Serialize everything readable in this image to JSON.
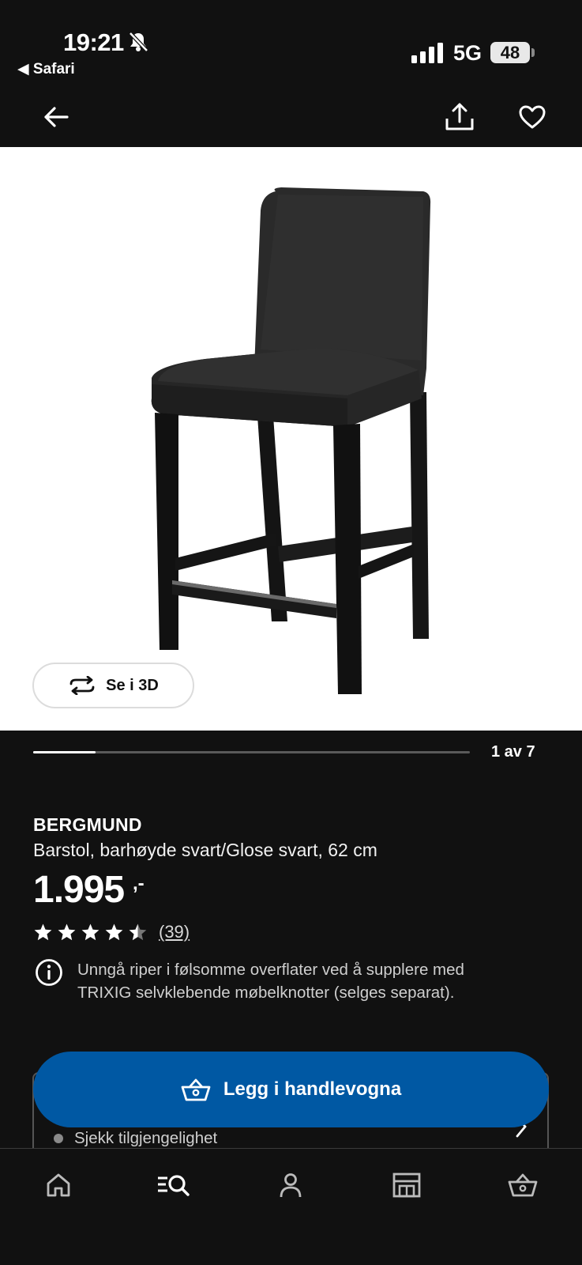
{
  "status": {
    "time": "19:21",
    "back_app": "◀ Safari",
    "network": "5G",
    "battery": "48"
  },
  "product": {
    "view_3d_label": "Se i 3D",
    "gallery": {
      "position": "1 av 7",
      "progress_fraction": 0.143
    },
    "brand": "BERGMUND",
    "description": "Barstol, barhøyde svart/Glose svart, 62 cm",
    "price": "1.995",
    "price_suffix": ",-",
    "rating": {
      "value": 4.5,
      "max": 5,
      "count_label": "(39)"
    },
    "info_text": "Unngå riper i følsomme overflater ved å supplere med TRIXIG selvklebende møbelknotter (selges separat)."
  },
  "actions": {
    "add_to_cart": "Legg i handlevogna",
    "availability": "Sjekk tilgjengelighet"
  },
  "icons": {
    "nav": [
      "back-arrow-icon",
      "share-icon",
      "heart-icon"
    ],
    "tabs": [
      "home-icon",
      "search-icon",
      "profile-icon",
      "store-icon",
      "cart-icon"
    ]
  },
  "colors": {
    "background": "#111111",
    "accent_blue": "#0058a3",
    "image_background": "#ffffff"
  }
}
